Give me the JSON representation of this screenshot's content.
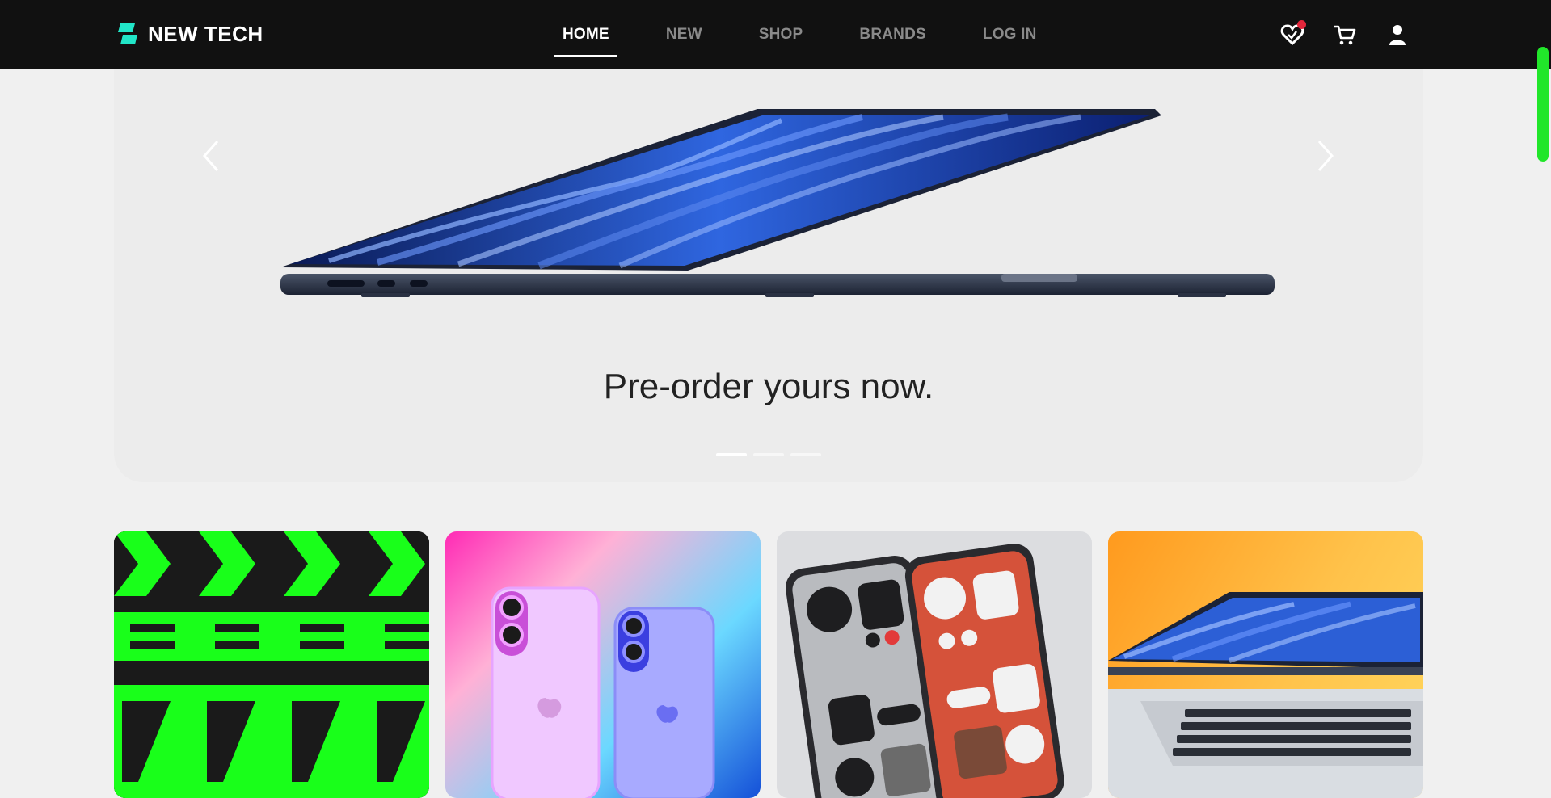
{
  "brand": {
    "name": "NEW TECH",
    "accent": "#21e6c8"
  },
  "nav": {
    "links": [
      {
        "label": "HOME",
        "active": true
      },
      {
        "label": "NEW",
        "active": false
      },
      {
        "label": "SHOP",
        "active": false
      },
      {
        "label": "BRANDS",
        "active": false
      },
      {
        "label": "LOG IN",
        "active": false
      }
    ]
  },
  "icons": {
    "favorites": "heart-icon",
    "cart": "cart-icon",
    "account": "user-icon",
    "notification_color": "#e3263b"
  },
  "hero": {
    "caption": "Pre-order yours now.",
    "slide_count": 3,
    "active_slide": 1
  },
  "cards": [
    {
      "name": "zigzag-pattern-card"
    },
    {
      "name": "colorful-phones-card"
    },
    {
      "name": "android-phones-card"
    },
    {
      "name": "laptop-promo-card"
    }
  ],
  "colors": {
    "scrollbar": "#21e62a",
    "navbar": "#111111",
    "page_bg": "#f0f0f0"
  }
}
